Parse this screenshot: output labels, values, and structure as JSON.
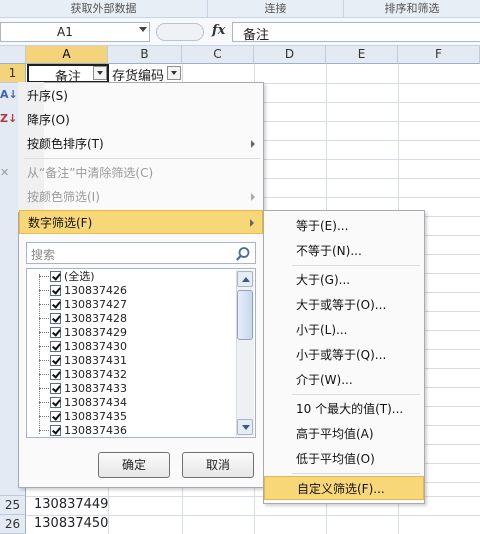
{
  "ribbon": {
    "groups": [
      "获取外部数据",
      "连接",
      "排序和筛选"
    ]
  },
  "formula_bar": {
    "name_box": "A1",
    "fx_label": "fx",
    "content": "备注"
  },
  "columns": [
    "A",
    "B",
    "C",
    "D",
    "E",
    "F"
  ],
  "rows_top": [
    "1"
  ],
  "rows_bottom": [
    "25",
    "26"
  ],
  "cells": {
    "A1": "备注",
    "B1": "存货编码",
    "A25": "130837449",
    "A26": "130837450"
  },
  "filter_menu": {
    "items": [
      {
        "label": "升序(S)",
        "enabled": true
      },
      {
        "label": "降序(O)",
        "enabled": true
      },
      {
        "label": "按颜色排序(T)",
        "enabled": true,
        "submenu": true
      },
      {
        "label": "从“备注”中清除筛选(C)",
        "enabled": false
      },
      {
        "label": "按颜色筛选(I)",
        "enabled": false,
        "submenu": true
      },
      {
        "label": "数字筛选(F)",
        "enabled": true,
        "submenu": true,
        "highlighted": true
      }
    ],
    "search_placeholder": "搜索",
    "list": [
      {
        "label": "(全选)",
        "checked": true
      },
      {
        "label": "130837426",
        "checked": true
      },
      {
        "label": "130837427",
        "checked": true
      },
      {
        "label": "130837428",
        "checked": true
      },
      {
        "label": "130837429",
        "checked": true
      },
      {
        "label": "130837430",
        "checked": true
      },
      {
        "label": "130837431",
        "checked": true
      },
      {
        "label": "130837432",
        "checked": true
      },
      {
        "label": "130837433",
        "checked": true
      },
      {
        "label": "130837434",
        "checked": true
      },
      {
        "label": "130837435",
        "checked": true
      },
      {
        "label": "130837436",
        "checked": true
      }
    ],
    "ok_label": "确定",
    "cancel_label": "取消"
  },
  "number_filter_submenu": {
    "items": [
      {
        "label": "等于(E)..."
      },
      {
        "label": "不等于(N)..."
      },
      {
        "label": "大于(G)..."
      },
      {
        "label": "大于或等于(O)..."
      },
      {
        "label": "小于(L)..."
      },
      {
        "label": "小于或等于(Q)..."
      },
      {
        "label": "介于(W)..."
      },
      {
        "label": "10 个最大的值(T)..."
      },
      {
        "label": "高于平均值(A)"
      },
      {
        "label": "低于平均值(O)"
      },
      {
        "label": "自定义筛选(F)...",
        "highlighted": true
      }
    ]
  },
  "colors": {
    "highlight": "#f7d778",
    "header_selected": "#f4d47a"
  }
}
